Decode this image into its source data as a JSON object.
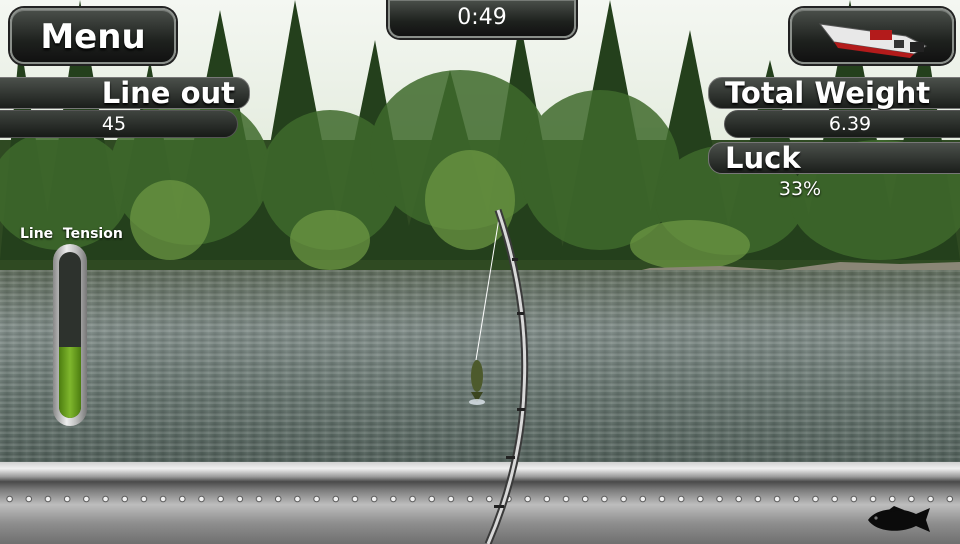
{
  "hud": {
    "menu_label": "Menu",
    "timer": "0:49",
    "line_out_label": "Line out",
    "line_out_value": "45",
    "total_weight_label": "Total Weight",
    "total_weight_value": "6.39",
    "luck_label": "Luck",
    "luck_value": "33%",
    "line_tension_label": "Line  Tension",
    "line_tension_fraction": 0.43
  },
  "icons": {
    "boat": "boat-icon",
    "bass": "bass-fish-icon"
  },
  "colors": {
    "tension_fill": "#7fb72d",
    "hud_panel": "#1e211e"
  }
}
